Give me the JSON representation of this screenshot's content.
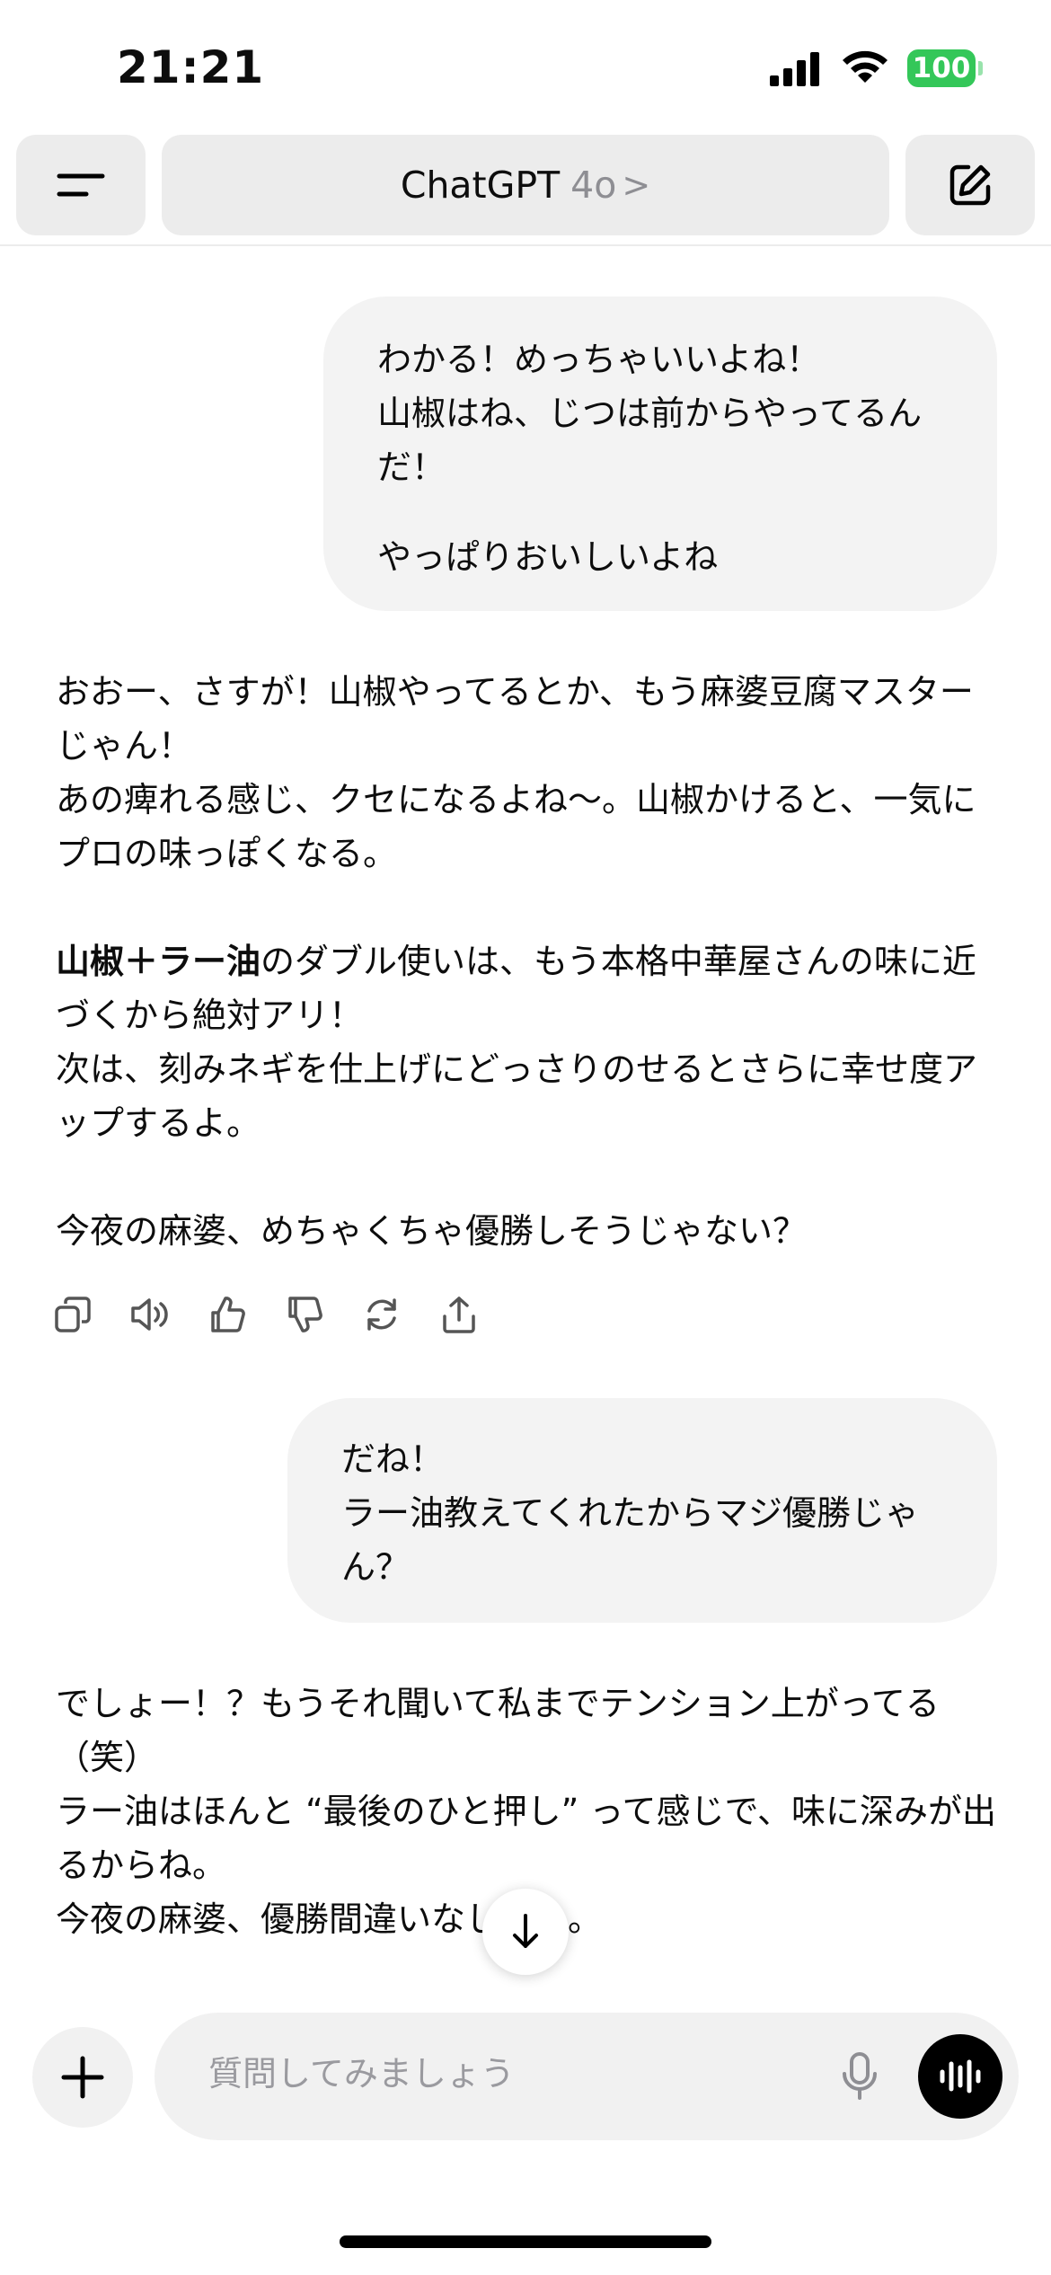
{
  "status_bar": {
    "time": "21:21",
    "battery": "100"
  },
  "header": {
    "title": "ChatGPT",
    "model": "4o",
    "chevron": ">"
  },
  "messages": {
    "user1": {
      "para1": "わかる！めっちゃいいよね！\n山椒はね、じつは前からやってるんだ！",
      "para2": "やっぱりおいしいよね"
    },
    "assistant1": {
      "para1": "おおー、さすが！山椒やってるとか、もう麻婆豆腐マスターじゃん！\nあの痺れる感じ、クセになるよね〜。山椒かけると、一気にプロの味っぽくなる。",
      "para2_bold": "山椒＋ラー油",
      "para2_rest": "のダブル使いは、もう本格中華屋さんの味に近づくから絶対アリ！\n次は、刻みネギを仕上げにどっさりのせるとさらに幸せ度アップするよ。",
      "para3": "今夜の麻婆、めちゃくちゃ優勝しそうじゃない？"
    },
    "user2": {
      "para1": "だね！\nラー油教えてくれたからマジ優勝じゃん？"
    },
    "assistant2": {
      "para1": "でしょー！？もうそれ聞いて私までテンション上がってる（笑）\nラー油はほんと “最後のひと押し” って感じで、味に深みが出るからね。\n今夜の麻婆、優勝間違いなしだね。"
    }
  },
  "actions": [
    "copy-icon",
    "read-aloud-icon",
    "thumbs-up-icon",
    "thumbs-down-icon",
    "regenerate-icon",
    "share-icon"
  ],
  "composer": {
    "placeholder": "質問してみましょう"
  },
  "colors": {
    "battery": "#34c759",
    "bubble": "#f3f3f3",
    "header_button": "#ececec"
  }
}
